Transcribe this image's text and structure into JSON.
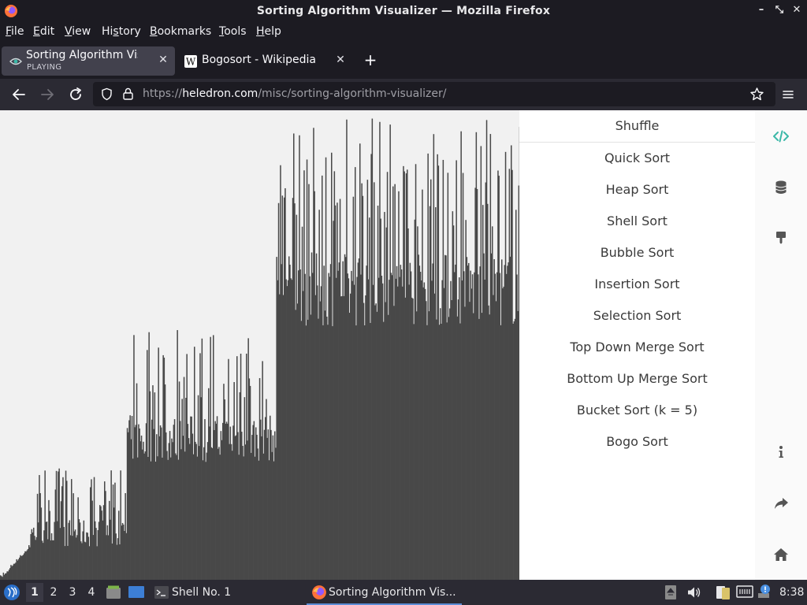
{
  "window": {
    "title": "Sorting Algorithm Visualizer — Mozilla Firefox"
  },
  "menu": [
    {
      "label": "File",
      "key": "F"
    },
    {
      "label": "Edit",
      "key": "E"
    },
    {
      "label": "View",
      "key": "V"
    },
    {
      "label": "History",
      "key": "s"
    },
    {
      "label": "Bookmarks",
      "key": "B"
    },
    {
      "label": "Tools",
      "key": "T"
    },
    {
      "label": "Help",
      "key": "H"
    }
  ],
  "tabs": [
    {
      "title": "Sorting Algorithm Visualizer",
      "subtitle": "PLAYING",
      "active": true
    },
    {
      "title": "Bogosort - Wikipedia",
      "subtitle": "",
      "active": false
    }
  ],
  "url": {
    "prefix": "https://",
    "host": "heledron.com",
    "path": "/misc/sorting-algorithm-visualizer/"
  },
  "algorithms": [
    "Shuffle",
    "Quick Sort",
    "Heap Sort",
    "Shell Sort",
    "Bubble Sort",
    "Insertion Sort",
    "Selection Sort",
    "Top Down Merge Sort",
    "Bottom Up Merge Sort",
    "Bucket Sort (k = 5)",
    "Bogo Sort"
  ],
  "sidebar_icons": [
    "code-icon",
    "database-icon",
    "paint-brush-icon",
    "info-icon",
    "share-icon",
    "home-icon"
  ],
  "colors": {
    "bar": "#484848",
    "accent": "#3bb8a8",
    "panel_bg": "#ffffff"
  },
  "visualizer": {
    "buckets": [
      {
        "level": 0.07,
        "peak": 0.24
      },
      {
        "level": 0.25,
        "peak": 0.54
      },
      {
        "level": 0.5,
        "peak": 0.73
      },
      {
        "level": 0.54,
        "peak": 0.99
      }
    ]
  },
  "taskbar": {
    "workspaces": [
      "1",
      "2",
      "3",
      "4"
    ],
    "active_workspace": "1",
    "terminal": "Shell No. 1",
    "firefox_task": "Sorting Algorithm Vis...",
    "clock": "8:38"
  }
}
